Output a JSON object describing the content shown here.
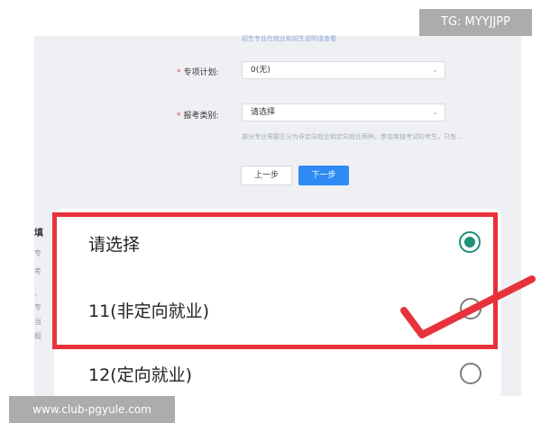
{
  "form": {
    "top_note": "招生专业在就业和招生说明请查看",
    "special_plan": {
      "label": "专项计划:",
      "value": "0(无)"
    },
    "apply_type": {
      "label": "报考类别:",
      "value": "请选择"
    },
    "hint": "部分专业需要区分为非定向就业和定向就业两种，参加单独考试的考生，只有…",
    "prev_button": "上一步",
    "next_button": "下一步",
    "side_title": "填",
    "side_fragments": [
      "专",
      "考",
      "、",
      "专",
      "当",
      "报"
    ],
    "required_mark": "*"
  },
  "sheet": {
    "options": [
      {
        "label": "请选择",
        "checked": true
      },
      {
        "label": "11(非定向就业)",
        "checked": false
      },
      {
        "label": "12(定向就业)",
        "checked": false
      }
    ]
  },
  "watermarks": {
    "tag": "TG: MYYJJPP",
    "url": "www.club-pgyule.com"
  },
  "colors": {
    "highlight": "#e8323b",
    "radio_selected": "#1e8f78",
    "primary_button": "#2e8af5"
  }
}
